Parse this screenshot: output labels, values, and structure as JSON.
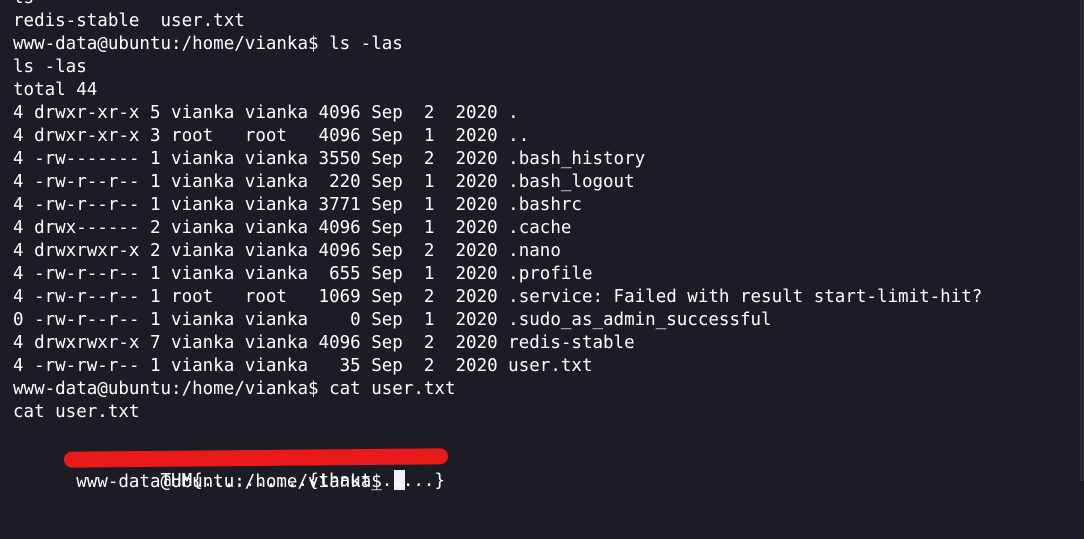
{
  "terminal": {
    "lines": [
      "ls",
      "redis-stable  user.txt",
      "www-data@ubuntu:/home/vianka$ ls -las",
      "ls -las",
      "total 44",
      "4 drwxr-xr-x 5 vianka vianka 4096 Sep  2  2020 .",
      "4 drwxr-xr-x 3 root   root   4096 Sep  1  2020 ..",
      "4 -rw------- 1 vianka vianka 3550 Sep  2  2020 .bash_history",
      "4 -rw-r--r-- 1 vianka vianka  220 Sep  1  2020 .bash_logout",
      "4 -rw-r--r-- 1 vianka vianka 3771 Sep  1  2020 .bashrc",
      "4 drwx------ 2 vianka vianka 4096 Sep  1  2020 .cache",
      "4 drwxrwxr-x 2 vianka vianka 4096 Sep  2  2020 .nano",
      "4 -rw-r--r-- 1 vianka vianka  655 Sep  1  2020 .profile",
      "4 -rw-r--r-- 1 root   root   1069 Sep  2  2020 .service: Failed with result start-limit-hit?",
      "0 -rw-r--r-- 1 vianka vianka    0 Sep  1  2020 .sudo_as_admin_successful",
      "4 drwxrwxr-x 7 vianka vianka 4096 Sep  2  2020 redis-stable",
      "4 -rw-rw-r-- 1 vianka vianka   35 Sep  2  2020 user.txt",
      "www-data@ubuntu:/home/vianka$ cat user.txt",
      "cat user.txt"
    ],
    "redacted_line": "THM{..........{thaut_.....}",
    "prompt": "www-data@ubuntu:/home/vianka$ "
  }
}
